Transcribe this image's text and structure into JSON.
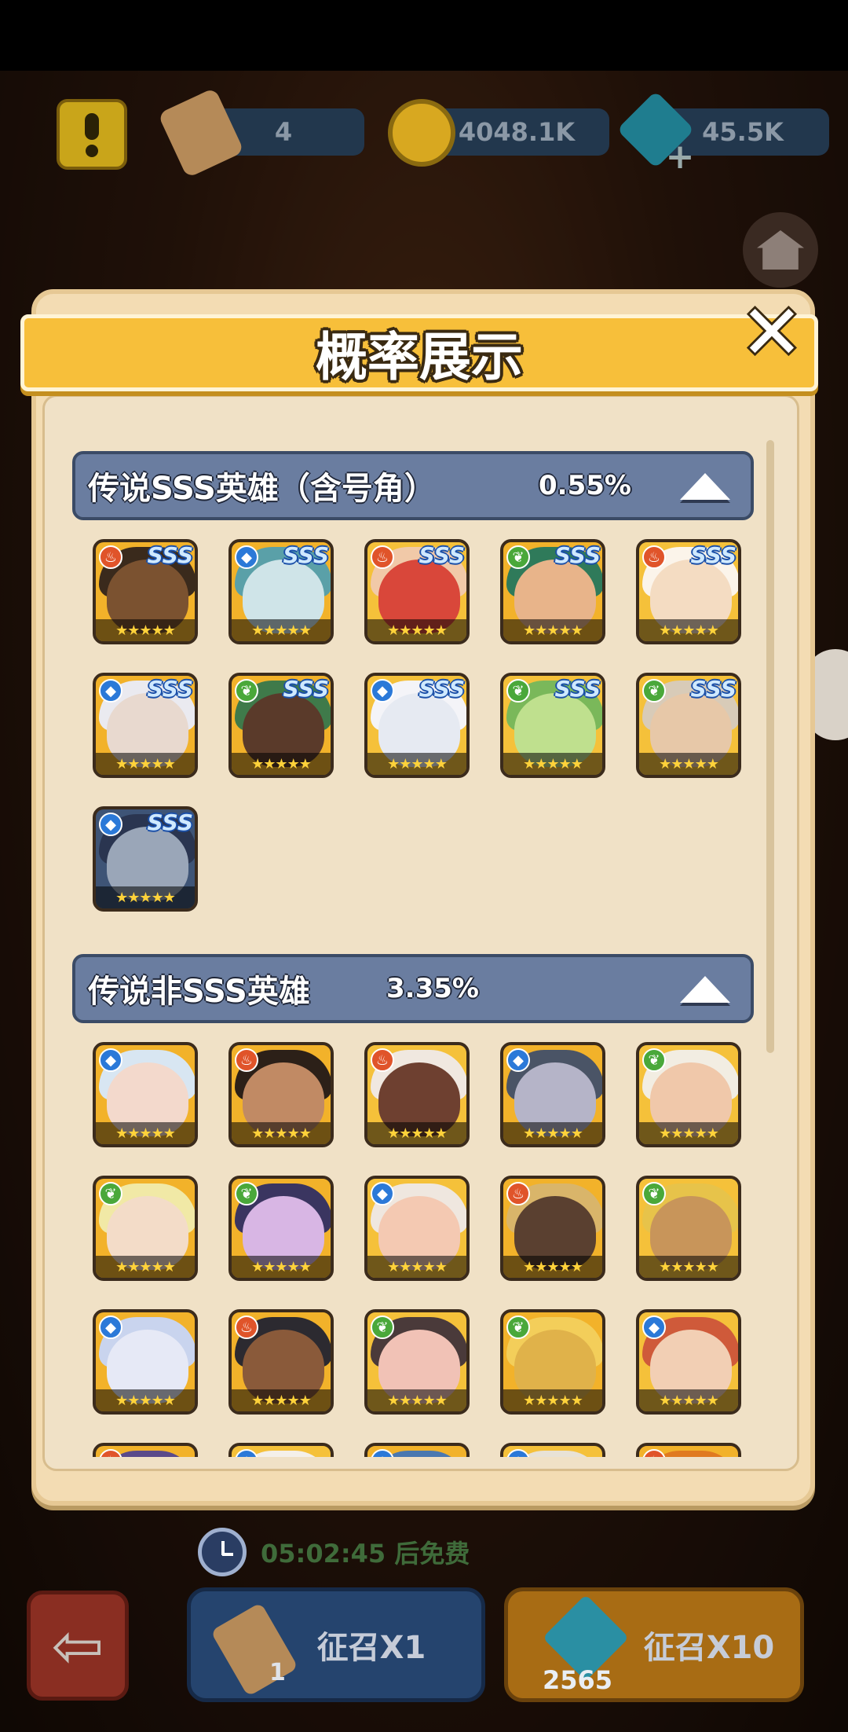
{
  "hud": {
    "scrolls": "4",
    "gold": "4048.1K",
    "gems": "45.5K"
  },
  "dialog": {
    "title": "概率展示",
    "close": "✕"
  },
  "sections": [
    {
      "name": "传说SSS英雄（含号角）",
      "rate": "0.55%",
      "heroes": [
        {
          "element": "fire",
          "sss": "SSS",
          "skin": "#7b5230",
          "hair": "#3a2a1c",
          "bg": "#f2b22a"
        },
        {
          "element": "water",
          "sss": "SSS",
          "skin": "#cfe4e8",
          "hair": "#5aa0a8",
          "bg": "#f2b22a"
        },
        {
          "element": "fire",
          "sss": "SSS",
          "skin": "#d9473a",
          "hair": "#f1c9a8",
          "bg": "#f5c13a"
        },
        {
          "element": "leaf",
          "sss": "SSS",
          "skin": "#e8b48a",
          "hair": "#2f7a5a",
          "bg": "#f2b22a"
        },
        {
          "element": "fire",
          "sss": "SSS",
          "skin": "#f4dcc2",
          "hair": "#fbf4ea",
          "bg": "#f5c13a"
        },
        {
          "element": "water",
          "sss": "SSS",
          "skin": "#e8d9cf",
          "hair": "#eaeaf0",
          "bg": "#f2b22a"
        },
        {
          "element": "leaf",
          "sss": "SSS",
          "skin": "#5a3a2a",
          "hair": "#3f7a4a",
          "bg": "#f2b22a"
        },
        {
          "element": "water",
          "sss": "SSS",
          "skin": "#e6eaf2",
          "hair": "#f4f4f8",
          "bg": "#f5c13a"
        },
        {
          "element": "leaf",
          "sss": "SSS",
          "skin": "#bfe08e",
          "hair": "#7ab85a",
          "bg": "#f5c13a"
        },
        {
          "element": "leaf",
          "sss": "SSS",
          "skin": "#e7c8a8",
          "hair": "#d8cbb8",
          "bg": "#f5c13a"
        },
        {
          "element": "water",
          "sss": "SSS",
          "skin": "#9aa6b8",
          "hair": "#2a3550",
          "bg": "#3e5476"
        }
      ]
    },
    {
      "name": "传说非SSS英雄",
      "rate": "3.35%",
      "heroes": [
        {
          "element": "water",
          "sss": "",
          "skin": "#f3d9cc",
          "hair": "#d8e6f2",
          "bg": "#f2b22a"
        },
        {
          "element": "fire",
          "sss": "",
          "skin": "#c18a64",
          "hair": "#2c2018",
          "bg": "#f2b22a"
        },
        {
          "element": "fire",
          "sss": "",
          "skin": "#6e4030",
          "hair": "#f0e8e0",
          "bg": "#f5c13a"
        },
        {
          "element": "water",
          "sss": "",
          "skin": "#b5b4c8",
          "hair": "#4a5466",
          "bg": "#f2b22a"
        },
        {
          "element": "leaf",
          "sss": "",
          "skin": "#f0c8aa",
          "hair": "#f2ede2",
          "bg": "#f5c13a"
        },
        {
          "element": "leaf",
          "sss": "",
          "skin": "#f3dcc8",
          "hair": "#f1e9a6",
          "bg": "#f2b22a"
        },
        {
          "element": "leaf",
          "sss": "",
          "skin": "#d8b6e4",
          "hair": "#3a3560",
          "bg": "#f2b22a"
        },
        {
          "element": "water",
          "sss": "",
          "skin": "#f4c9b2",
          "hair": "#efe7df",
          "bg": "#f5c13a"
        },
        {
          "element": "fire",
          "sss": "",
          "skin": "#5a4030",
          "hair": "#d9b56a",
          "bg": "#f2b22a"
        },
        {
          "element": "leaf",
          "sss": "",
          "skin": "#c8955a",
          "hair": "#e7c34a",
          "bg": "#f5c13a"
        },
        {
          "element": "water",
          "sss": "",
          "skin": "#e6e9f6",
          "hair": "#c9d4ee",
          "bg": "#f2b22a"
        },
        {
          "element": "fire",
          "sss": "",
          "skin": "#8a5a3a",
          "hair": "#2c2a30",
          "bg": "#f2b22a"
        },
        {
          "element": "leaf",
          "sss": "",
          "skin": "#f1c2b6",
          "hair": "#4a3a3a",
          "bg": "#f5c13a"
        },
        {
          "element": "leaf",
          "sss": "",
          "skin": "#e0b24a",
          "hair": "#f3ce5a",
          "bg": "#f2b22a"
        },
        {
          "element": "water",
          "sss": "",
          "skin": "#f2cfb4",
          "hair": "#cf5a3a",
          "bg": "#f5c13a"
        },
        {
          "element": "fire",
          "sss": "",
          "skin": "#8a6ab8",
          "hair": "#5a4a8a",
          "bg": "#f2b22a"
        },
        {
          "element": "water",
          "sss": "",
          "skin": "#f2d2b8",
          "hair": "#f4f0ea",
          "bg": "#f5c13a"
        },
        {
          "element": "water",
          "sss": "",
          "skin": "#8ab8e0",
          "hair": "#4a78b0",
          "bg": "#f2b22a"
        },
        {
          "element": "water",
          "sss": "",
          "skin": "#f0d8b8",
          "hair": "#e8e2d6",
          "bg": "#f5c13a"
        },
        {
          "element": "fire",
          "sss": "",
          "skin": "#f0a040",
          "hair": "#e07a20",
          "bg": "#f2b22a"
        }
      ]
    }
  ],
  "stars": "★★★★★",
  "bottom": {
    "timer": "05:02:45 后免费",
    "summon1_label": "征召X1",
    "summon1_count": "1",
    "summon10_label": "征召X10",
    "summon10_cost": "2565"
  }
}
